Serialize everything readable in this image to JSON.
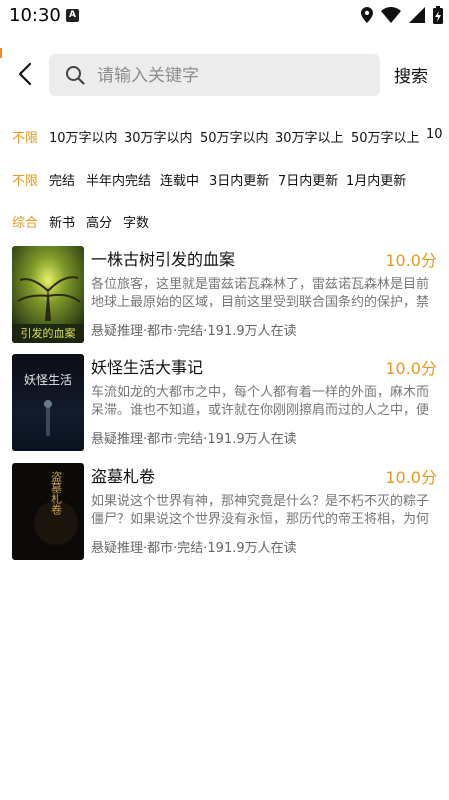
{
  "status_bar": {
    "time": "10:30",
    "app_badge": "A"
  },
  "search": {
    "placeholder": "请输入关键字",
    "button_label": "搜索"
  },
  "filters": {
    "word_count": [
      "不限",
      "10万字以内",
      "30万字以内",
      "50万字以内",
      "30万字以上",
      "50万字以上",
      "10"
    ],
    "status": [
      "不限",
      "完结",
      "半年内完结",
      "连载中",
      "3日内更新",
      "7日内更新",
      "1月内更新"
    ],
    "sort": [
      "综合",
      "新书",
      "高分",
      "字数"
    ]
  },
  "books": [
    {
      "title": "一株古树引发的血案",
      "score": "10.0分",
      "desc": "各位旅客，这里就是雷兹诺瓦森林了，雷兹诺瓦森林是目前地球上最原始的区域，目前这里受到联合国条约的保护，禁止…",
      "meta": "悬疑推理·都市·完结·191.9万人在读",
      "cover_text": "引发的血案"
    },
    {
      "title": "妖怪生活大事记",
      "score": "10.0分",
      "desc": "车流如龙的大都市之中，每个人都有着一样的外面，麻木而呆滞。谁也不知道，或许就在你刚刚擦肩而过的人之中，便有…",
      "meta": "悬疑推理·都市·完结·191.9万人在读",
      "cover_text": "妖怪生活"
    },
    {
      "title": "盗墓札卷",
      "score": "10.0分",
      "desc": "如果说这个世界有神，那神究竟是什么？是不朽不灭的粽子僵尸？如果说这个世界没有永恒，那历代的帝王将相，为何会…",
      "meta": "悬疑推理·都市·完结·191.9万人在读",
      "cover_text": "盗墓札卷"
    }
  ],
  "colors": {
    "accent": "#e69a1f",
    "search_bg": "#ececec"
  }
}
